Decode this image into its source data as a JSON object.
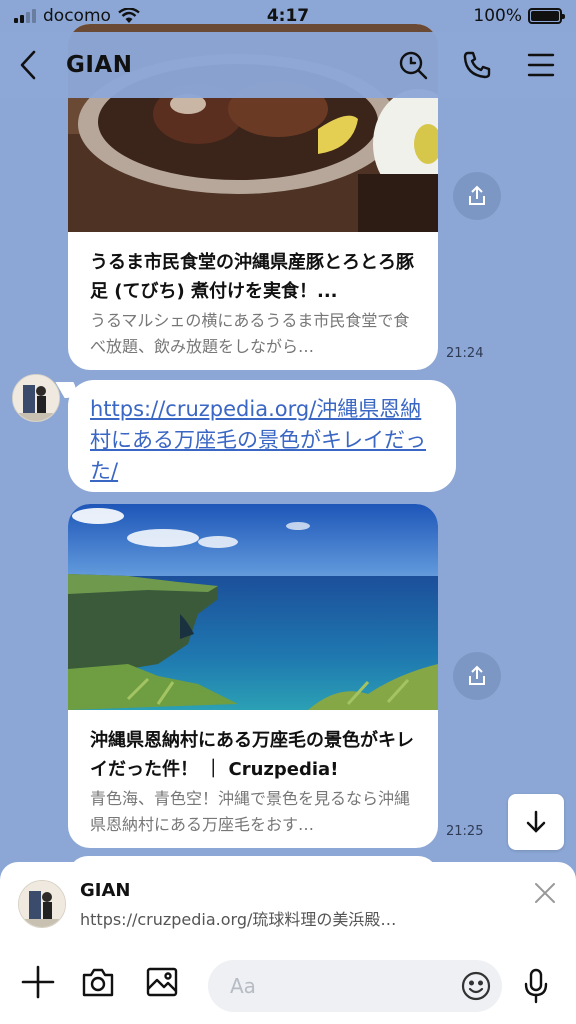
{
  "status_bar": {
    "carrier": "docomo",
    "time": "4:17",
    "battery": "100%"
  },
  "header": {
    "title": "GIAN"
  },
  "messages": [
    {
      "title": "うるま市民食堂の沖縄県産豚とろとろ豚足 (てびち) 煮付けを実食！...",
      "desc": "うるマルシェの横にあるうるま市民食堂で食べ放題、飲み放題をしながら…",
      "time": "21:24"
    },
    {
      "link": "https://cruzpedia.org/沖縄県恩納村にある万座毛の景色がキレイだった/"
    },
    {
      "title": "沖縄県恩納村にある万座毛の景色がキレイだった件！ ｜ Cruzpedia!",
      "desc": "青色海、青色空！沖縄で景色を見るなら沖縄県恩納村にある万座毛をおす…",
      "time": "21:25"
    }
  ],
  "reply_preview": {
    "name": "GIAN",
    "text": "https://cruzpedia.org/琉球料理の美浜殿…"
  },
  "input": {
    "placeholder": "Aa"
  },
  "icons": {
    "back": "chevron-left-icon",
    "search": "search-icon",
    "call": "phone-icon",
    "menu": "menu-icon",
    "share": "share-icon",
    "scroll": "arrow-down-icon",
    "close": "close-icon",
    "add": "plus-icon",
    "camera": "camera-icon",
    "image": "image-icon",
    "emoji": "emoji-icon",
    "mic": "microphone-icon"
  }
}
